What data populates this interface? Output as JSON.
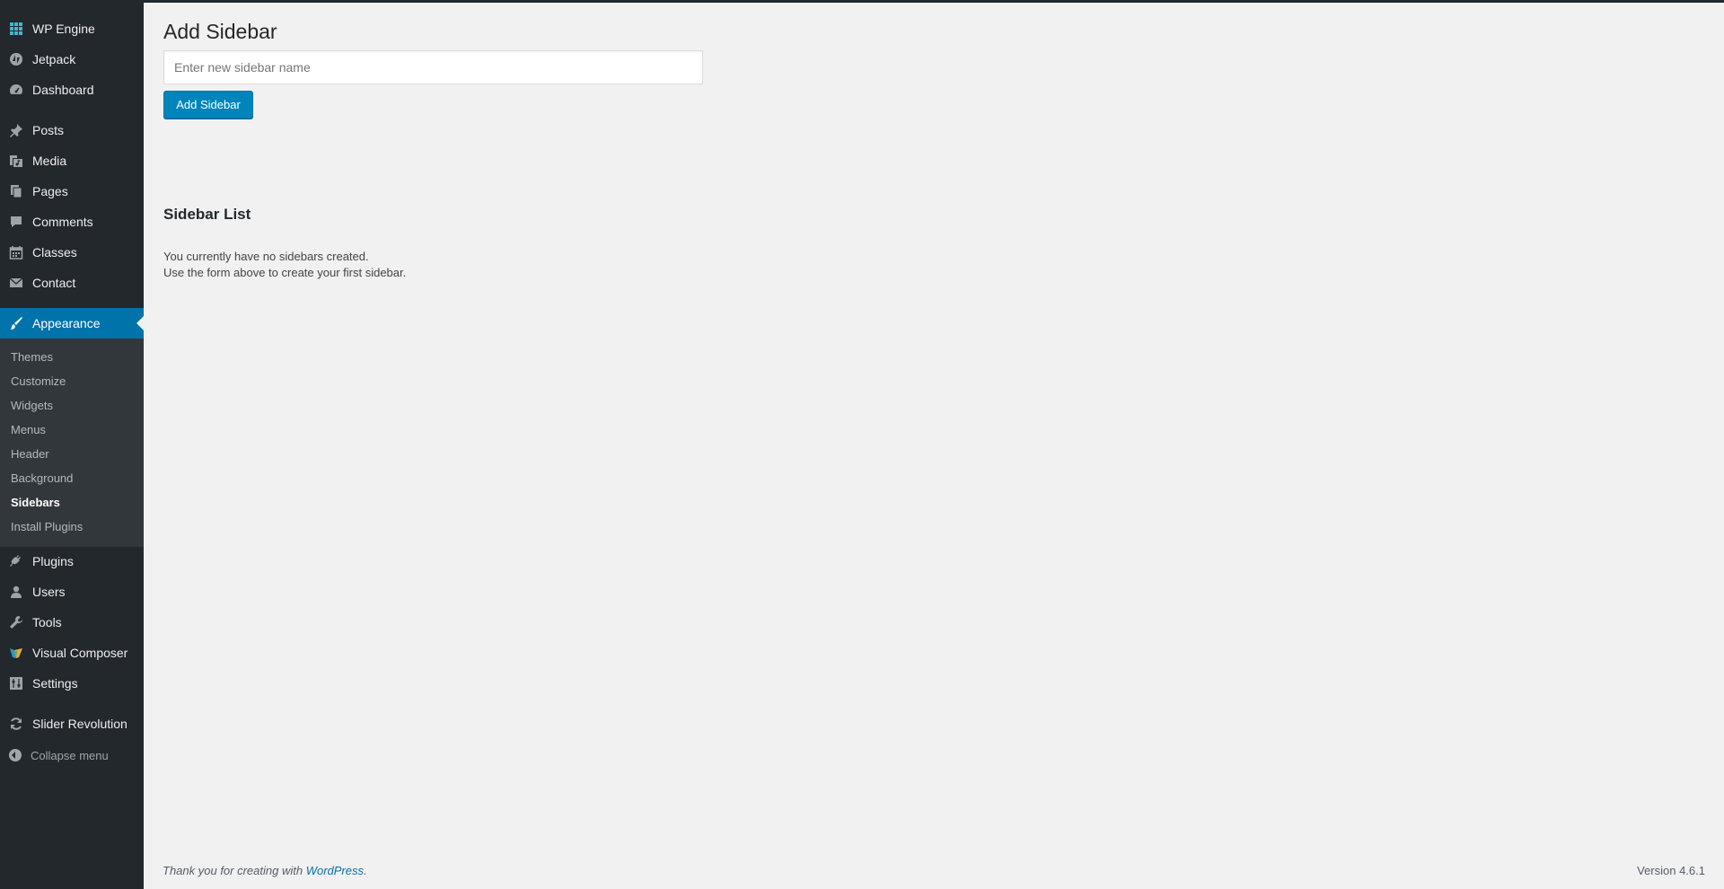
{
  "sidebar": {
    "items": [
      {
        "label": "WP Engine",
        "icon": "wp-engine-icon"
      },
      {
        "label": "Jetpack",
        "icon": "jetpack-icon"
      },
      {
        "label": "Dashboard",
        "icon": "dashboard-icon"
      },
      {
        "label": "Posts",
        "icon": "pin-icon"
      },
      {
        "label": "Media",
        "icon": "media-icon"
      },
      {
        "label": "Pages",
        "icon": "pages-icon"
      },
      {
        "label": "Comments",
        "icon": "comment-icon"
      },
      {
        "label": "Classes",
        "icon": "calendar-icon"
      },
      {
        "label": "Contact",
        "icon": "mail-icon"
      },
      {
        "label": "Appearance",
        "icon": "paintbrush-icon",
        "current": true
      },
      {
        "label": "Plugins",
        "icon": "plug-icon"
      },
      {
        "label": "Users",
        "icon": "user-icon"
      },
      {
        "label": "Tools",
        "icon": "wrench-icon"
      },
      {
        "label": "Visual Composer",
        "icon": "visual-composer-icon"
      },
      {
        "label": "Settings",
        "icon": "settings-icon"
      },
      {
        "label": "Slider Revolution",
        "icon": "refresh-icon"
      }
    ],
    "submenu": [
      "Themes",
      "Customize",
      "Widgets",
      "Menus",
      "Header",
      "Background",
      "Sidebars",
      "Install Plugins"
    ],
    "submenu_current": "Sidebars",
    "collapse_label": "Collapse menu"
  },
  "main": {
    "title": "Add Sidebar",
    "input_placeholder": "Enter new sidebar name",
    "input_value": "",
    "button_label": "Add Sidebar",
    "list_title": "Sidebar List",
    "empty_line1": "You currently have no sidebars created.",
    "empty_line2": "Use the form above to create your first sidebar."
  },
  "footer": {
    "thanks_prefix": "Thank you for creating with ",
    "thanks_link": "WordPress",
    "thanks_suffix": ".",
    "version": "Version 4.6.1"
  },
  "colors": {
    "sidebar_bg": "#23282d",
    "submenu_bg": "#32373c",
    "accent": "#0073aa",
    "button": "#0085ba",
    "page_bg": "#f1f1f1"
  }
}
